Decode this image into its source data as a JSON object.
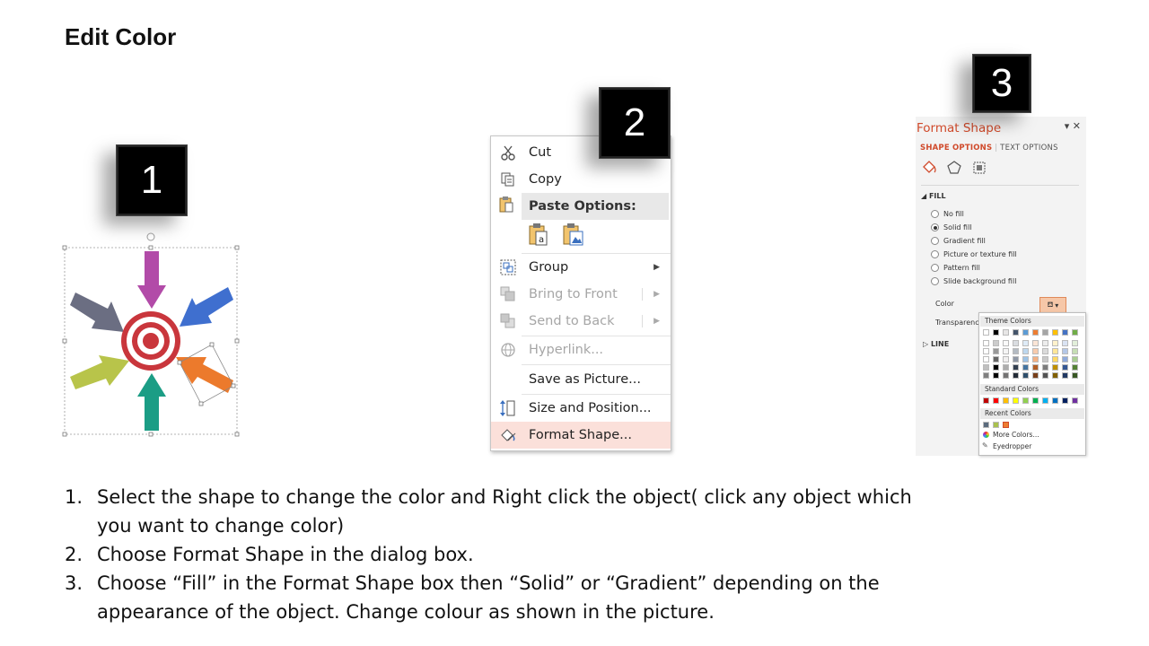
{
  "title": "Edit Color",
  "badges": [
    "1",
    "2",
    "3"
  ],
  "context_menu": {
    "items": [
      {
        "label": "Cut"
      },
      {
        "label": "Copy"
      },
      {
        "label": "Paste Options:"
      },
      {
        "label": "Group"
      },
      {
        "label": "Bring to Front"
      },
      {
        "label": "Send to Back"
      },
      {
        "label": "Hyperlink..."
      },
      {
        "label": "Save as Picture..."
      },
      {
        "label": "Size and Position..."
      },
      {
        "label": "Format Shape..."
      }
    ]
  },
  "format_pane": {
    "title": "Format Shape",
    "tab_shape": "SHAPE OPTIONS",
    "tab_text": "TEXT OPTIONS",
    "fill_section": "FILL",
    "fill_options": [
      "No fill",
      "Solid fill",
      "Gradient fill",
      "Picture or texture fill",
      "Pattern fill",
      "Slide background fill"
    ],
    "color_label": "Color",
    "transparency_label": "Transparency",
    "line_section": "LINE",
    "palette": {
      "theme_header": "Theme Colors",
      "standard_header": "Standard Colors",
      "recent_header": "Recent Colors",
      "more_colors": "More Colors...",
      "eyedropper": "Eyedropper"
    }
  },
  "colors": {
    "accent": "#d04a2b",
    "arrow_magenta": "#b24ba8",
    "arrow_blue": "#3f6fcf",
    "arrow_orange": "#ec7a2c",
    "arrow_teal": "#1b9d85",
    "arrow_green": "#b8c44a",
    "arrow_gray": "#6b6e82",
    "target_red": "#c9363c"
  },
  "steps": [
    {
      "num": "1.",
      "text": "Select the shape to change the color and Right click the object( click any object which you want to change color)"
    },
    {
      "num": "2.",
      "text": "Choose Format Shape in the dialog box."
    },
    {
      "num": "3.",
      "text": "Choose “Fill” in the Format Shape box then “Solid” or “Gradient” depending on the appearance of the object. Change colour as shown in the picture."
    }
  ]
}
